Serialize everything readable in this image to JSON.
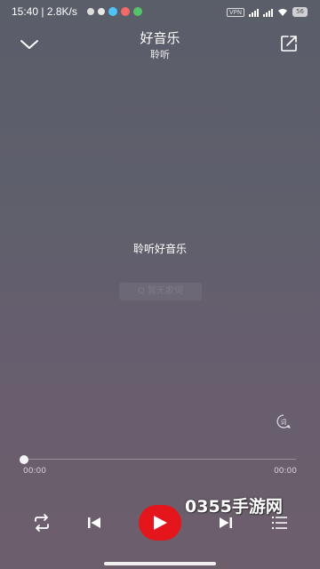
{
  "status_bar": {
    "time": "15:40 | 2.8K/s",
    "vpn": "VPN",
    "battery": "56"
  },
  "header": {
    "title": "好音乐",
    "subtitle": "聆听"
  },
  "player": {
    "center_title": "聆听好音乐",
    "search_lyrics": "Q 暂无歌词",
    "time_current": "00:00",
    "time_total": "00:00",
    "progress": 0
  },
  "watermark": "0355手游网",
  "colors": {
    "play_button": "#e4161b",
    "background_top": "#5a5e69",
    "background_bottom": "#6d5e6b"
  },
  "icons": {
    "back": "chevron-down-icon",
    "share": "share-icon",
    "lyrics": "lyrics-icon",
    "repeat": "repeat-icon",
    "prev": "skip-previous-icon",
    "play": "play-icon",
    "next": "skip-next-icon",
    "playlist": "playlist-icon"
  }
}
